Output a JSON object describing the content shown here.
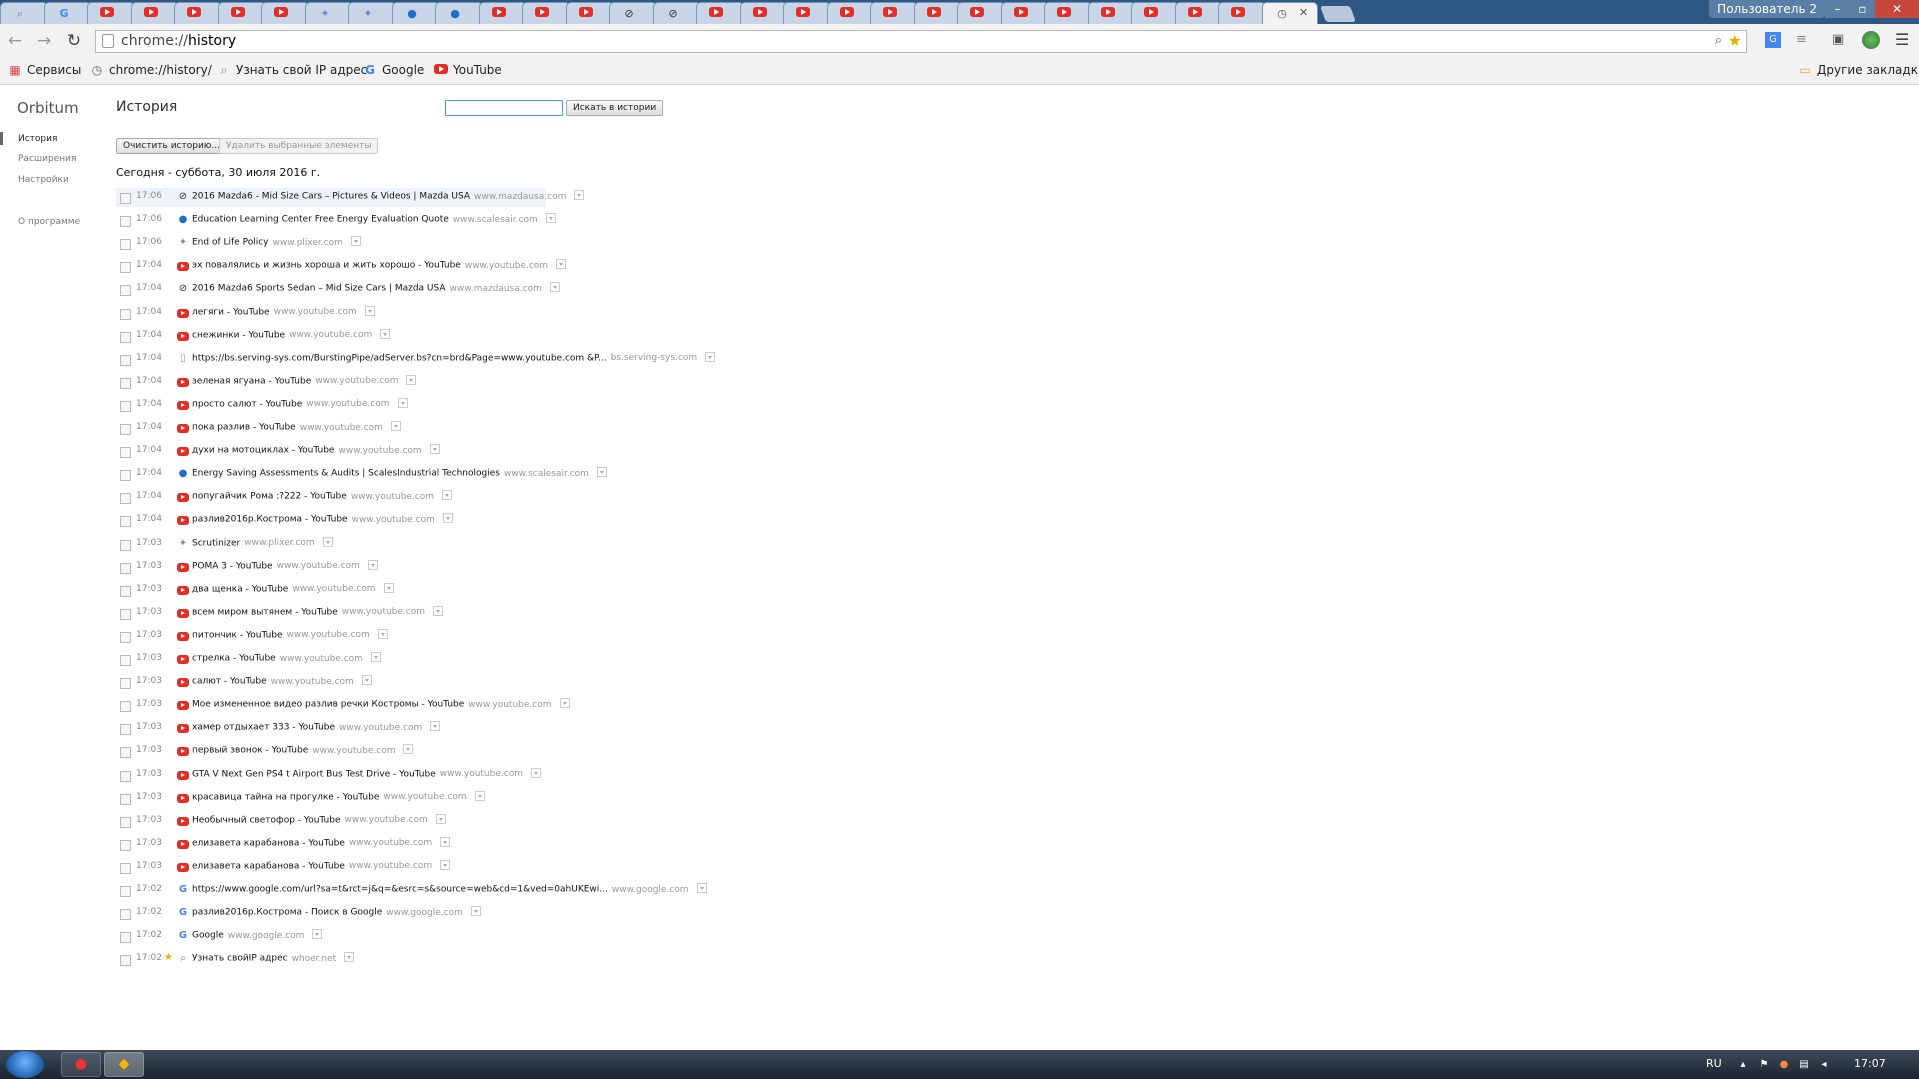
{
  "window": {
    "user_label": "Пользователь 2",
    "minimize": "–",
    "maximize": "▫",
    "close": "✕"
  },
  "tabs": [
    "search",
    "google",
    "youtube",
    "youtube",
    "youtube",
    "youtube",
    "youtube",
    "plixer",
    "plixer",
    "scalesair",
    "scalesair",
    "youtube",
    "youtube",
    "youtube",
    "mazda",
    "mazda",
    "youtube",
    "youtube",
    "youtube",
    "youtube",
    "youtube",
    "youtube",
    "youtube",
    "youtube",
    "youtube",
    "youtube",
    "youtube",
    "youtube",
    "youtube",
    "history"
  ],
  "toolbar": {
    "url_scheme": "chrome://",
    "url_path": "history"
  },
  "bookmarks": [
    {
      "label": "Сервисы",
      "icon": "apps-icon"
    },
    {
      "label": "chrome://history/",
      "icon": "history-icon"
    },
    {
      "label": "Узнать свой IP адрес",
      "icon": "search-icon"
    },
    {
      "label": "Google",
      "icon": "google-icon"
    },
    {
      "label": "YouTube",
      "icon": "youtube-icon"
    }
  ],
  "other_bookmarks": "Другие закладки",
  "sidebar": {
    "brand": "Orbitum",
    "items": [
      "История",
      "Расширения",
      "Настройки"
    ],
    "about": "О программе"
  },
  "main": {
    "title": "История",
    "search_placeholder": "",
    "search_button": "Искать в истории",
    "clear_button": "Очистить историю...",
    "remove_button": "Удалить выбранные элементы",
    "day_header": "Сегодня - суббота, 30 июля 2016 г."
  },
  "history": [
    {
      "time": "17:06",
      "icon": "mazda-icon",
      "title": "2016 Mazda6 - Mid Size Cars – Pictures & Videos | Mazda USA",
      "domain": "www.mazdausa.com"
    },
    {
      "time": "17:06",
      "icon": "globe-icon",
      "title": "Education Learning Center Free Energy Evaluation Quote",
      "domain": "www.scalesair.com"
    },
    {
      "time": "17:06",
      "icon": "plixer-icon",
      "title": "End of Life Policy",
      "domain": "www.plixer.com"
    },
    {
      "time": "17:04",
      "icon": "youtube-icon",
      "title": "эх повалялись и жизнь хороша и жить хорошо - YouTube",
      "domain": "www.youtube.com"
    },
    {
      "time": "17:04",
      "icon": "mazda-icon",
      "title": "2016 Mazda6 Sports Sedan – Mid Size Cars | Mazda USA",
      "domain": "www.mazdausa.com"
    },
    {
      "time": "17:04",
      "icon": "youtube-icon",
      "title": "легяги - YouTube",
      "domain": "www.youtube.com"
    },
    {
      "time": "17:04",
      "icon": "youtube-icon",
      "title": "снежинки - YouTube",
      "domain": "www.youtube.com"
    },
    {
      "time": "17:04",
      "icon": "page-icon",
      "title": "https://bs.serving-sys.com/BurstingPipe/adServer.bs?cn=brd&Page=www.youtube.com &P...",
      "domain": "bs.serving-sys.com"
    },
    {
      "time": "17:04",
      "icon": "youtube-icon",
      "title": "зеленая ягуана - YouTube",
      "domain": "www.youtube.com"
    },
    {
      "time": "17:04",
      "icon": "youtube-icon",
      "title": "просто салют - YouTube",
      "domain": "www.youtube.com"
    },
    {
      "time": "17:04",
      "icon": "youtube-icon",
      "title": "пока разлив - YouTube",
      "domain": "www.youtube.com"
    },
    {
      "time": "17:04",
      "icon": "youtube-icon",
      "title": "духи на мотоциклах - YouTube",
      "domain": "www.youtube.com"
    },
    {
      "time": "17:04",
      "icon": "globe-icon",
      "title": "Energy Saving Assessments & Audits | ScalesIndustrial Technologies",
      "domain": "www.scalesair.com"
    },
    {
      "time": "17:04",
      "icon": "youtube-icon",
      "title": "попугайчик Рома :?222 - YouTube",
      "domain": "www.youtube.com"
    },
    {
      "time": "17:04",
      "icon": "youtube-icon",
      "title": "разлив2016р.Кострома - YouTube",
      "domain": "www.youtube.com"
    },
    {
      "time": "17:03",
      "icon": "plixer-icon",
      "title": "Scrutinizer",
      "domain": "www.plixer.com"
    },
    {
      "time": "17:03",
      "icon": "youtube-icon",
      "title": "POMA 3 - YouTube",
      "domain": "www.youtube.com"
    },
    {
      "time": "17:03",
      "icon": "youtube-icon",
      "title": "два щенка - YouTube",
      "domain": "www.youtube.com"
    },
    {
      "time": "17:03",
      "icon": "youtube-icon",
      "title": "всем миром вытянем - YouTube",
      "domain": "www.youtube.com"
    },
    {
      "time": "17:03",
      "icon": "youtube-icon",
      "title": "питончик - YouTube",
      "domain": "www.youtube.com"
    },
    {
      "time": "17:03",
      "icon": "youtube-icon",
      "title": "стрелка - YouTube",
      "domain": "www.youtube.com"
    },
    {
      "time": "17:03",
      "icon": "youtube-icon",
      "title": "салют - YouTube",
      "domain": "www.youtube.com"
    },
    {
      "time": "17:03",
      "icon": "youtube-icon",
      "title": "Мое измененное видео разлив речки Костромы - YouTube",
      "domain": "www.youtube.com"
    },
    {
      "time": "17:03",
      "icon": "youtube-icon",
      "title": "хамер отдыхает 333 - YouTube",
      "domain": "www.youtube.com"
    },
    {
      "time": "17:03",
      "icon": "youtube-icon",
      "title": "первый звонок - YouTube",
      "domain": "www.youtube.com"
    },
    {
      "time": "17:03",
      "icon": "youtube-icon",
      "title": "GTA V Next Gen PS4 t Airport Bus Test Drive - YouTube",
      "domain": "www.youtube.com"
    },
    {
      "time": "17:03",
      "icon": "youtube-icon",
      "title": "красавица тайна на прогулке - YouTube",
      "domain": "www.youtube.com"
    },
    {
      "time": "17:03",
      "icon": "youtube-icon",
      "title": "Необычный светофор - YouTube",
      "domain": "www.youtube.com"
    },
    {
      "time": "17:03",
      "icon": "youtube-icon",
      "title": "елизавета карабанова - YouTube",
      "domain": "www.youtube.com"
    },
    {
      "time": "17:03",
      "icon": "youtube-icon",
      "title": "елизавета карабанова - YouTube",
      "domain": "www.youtube.com"
    },
    {
      "time": "17:02",
      "icon": "google-icon",
      "title": "https://www.google.com/url?sa=t&rct=j&q=&esrc=s&source=web&cd=1&ved=0ahUKEwi...",
      "domain": "www.google.com"
    },
    {
      "time": "17:02",
      "icon": "google-icon",
      "title": "разлив2016р.Кострома - Поиск в Google",
      "domain": "www.google.com"
    },
    {
      "time": "17:02",
      "icon": "google-icon",
      "title": "Google",
      "domain": "www.google.com"
    },
    {
      "time": "17:02",
      "icon": "search-icon",
      "title": "Узнать свойIP адрес",
      "domain": "whoer.net",
      "starred": true
    }
  ],
  "taskbar": {
    "lang": "RU",
    "time": "17:07"
  },
  "colors": {
    "youtube": "#e52d27",
    "google_blue": "#4285f4",
    "focus": "#4d90fe",
    "tabbar": "#2e5783"
  }
}
